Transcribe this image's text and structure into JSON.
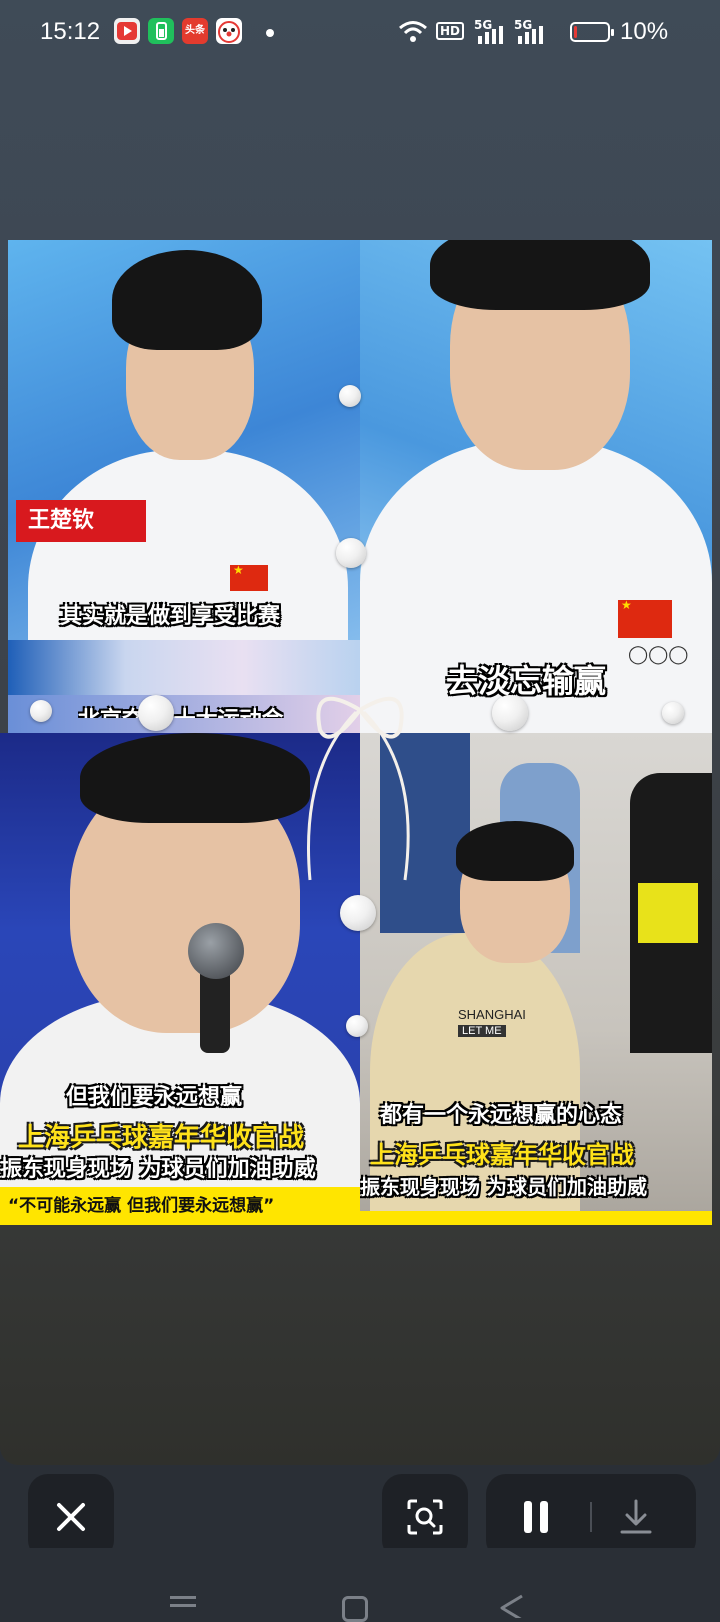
{
  "status_bar": {
    "time": "15:12",
    "network_hd": "HD",
    "network_1": "5G",
    "network_2": "5G",
    "battery_percent": "10%",
    "battery_level": 0.1,
    "app_icons": [
      "video-app-icon",
      "battery-app-icon",
      "toutiao-app-icon",
      "clown-app-icon"
    ],
    "toutiao_label": "头条"
  },
  "collage": {
    "panel1": {
      "name_tag": "王楚钦",
      "caption": "其实就是做到享受比赛",
      "cut_caption": "北京夺冠 十大运动会"
    },
    "panel2": {
      "caption": "去淡忘输赢"
    },
    "panel3": {
      "caption": "但我们要永远想赢",
      "headline": "上海乒乓球嘉年华收官战",
      "subheadline": "振东现身现场 为球员们加油助威",
      "quote": "“不可能永远赢 但我们要永远想赢”"
    },
    "panel4": {
      "shirt_text_1": "SHANGHAI",
      "shirt_text_2": "LET ME",
      "caption": "都有一个永远想赢的心态",
      "headline": "上海乒乓球嘉年华收官战",
      "subheadline": "振东现身现场 为球员们加油助威"
    }
  },
  "controls": {
    "close": "close-icon",
    "lens": "lens-search-icon",
    "pause": "pause-icon",
    "download": "download-icon"
  },
  "colors": {
    "caption_yellow": "#ffe21a",
    "name_tag_red": "#d8191e",
    "control_bg": "#1e2126"
  }
}
